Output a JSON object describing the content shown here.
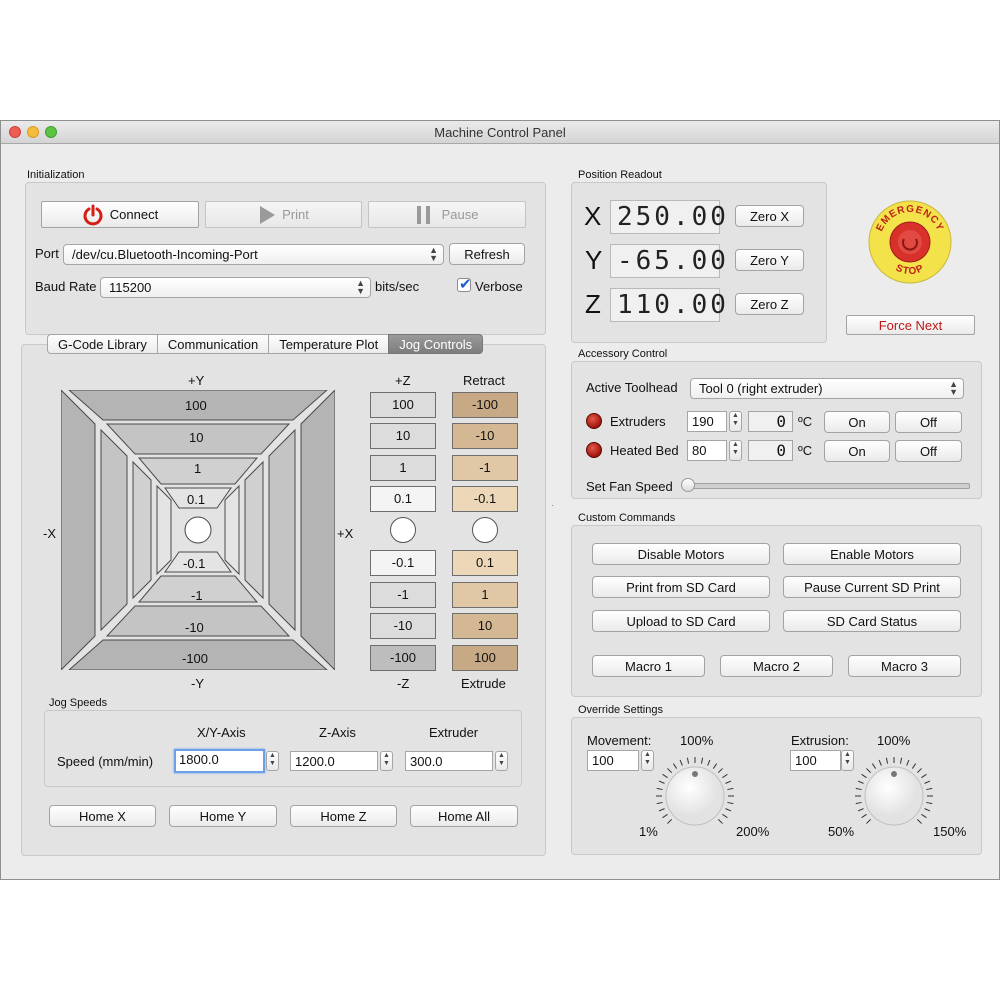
{
  "window": {
    "title": "Machine Control Panel"
  },
  "initialization": {
    "label": "Initialization",
    "connect": "Connect",
    "print": "Print",
    "pause": "Pause",
    "port_label": "Port",
    "port_value": "/dev/cu.Bluetooth-Incoming-Port",
    "refresh": "Refresh",
    "baud_label": "Baud Rate",
    "baud_value": "115200",
    "baud_unit": "bits/sec",
    "verbose": "Verbose",
    "verbose_checked": true
  },
  "tabs": [
    "G-Code Library",
    "Communication",
    "Temperature Plot",
    "Jog Controls"
  ],
  "active_tab": "Jog Controls",
  "jog": {
    "plus_y": "+Y",
    "minus_y": "-Y",
    "minus_x": "-X",
    "plus_x": "+X",
    "plus_z": "+Z",
    "minus_z": "-Z",
    "retract": "Retract",
    "extrude": "Extrude",
    "xy_labels": [
      "100",
      "10",
      "1",
      "0.1",
      "-0.1",
      "-1",
      "-10",
      "-100"
    ],
    "z_labels": [
      "100",
      "10",
      "1",
      "0.1",
      "-0.1",
      "-1",
      "-10",
      "-100"
    ],
    "e_labels": [
      "-100",
      "-10",
      "-1",
      "-0.1",
      "0.1",
      "1",
      "10",
      "100"
    ]
  },
  "jog_speeds": {
    "label": "Jog Speeds",
    "col_xy": "X/Y-Axis",
    "col_z": "Z-Axis",
    "col_e": "Extruder",
    "row_label": "Speed (mm/min)",
    "xy_value": "1800.0",
    "z_value": "1200.0",
    "e_value": "300.0"
  },
  "home": {
    "x": "Home X",
    "y": "Home Y",
    "z": "Home Z",
    "all": "Home All"
  },
  "position": {
    "label": "Position Readout",
    "x_label": "X",
    "x_value": "250.00",
    "zero_x": "Zero X",
    "y_label": "Y",
    "y_value": "-65.00",
    "zero_y": "Zero Y",
    "z_label": "Z",
    "z_value": "110.00",
    "zero_z": "Zero Z"
  },
  "emergency": {
    "top": "EMERGENCY",
    "bottom": "STOP",
    "force_next": "Force Next"
  },
  "accessory": {
    "label": "Accessory Control",
    "toolhead_label": "Active Toolhead",
    "toolhead_value": "Tool 0 (right extruder)",
    "extruders_label": "Extruders",
    "extruders_target": "190",
    "extruders_current": "0",
    "bed_label": "Heated Bed",
    "bed_target": "80",
    "bed_current": "0",
    "unit": "ºC",
    "on": "On",
    "off": "Off",
    "fan_label": "Set Fan Speed",
    "fan_level": 0
  },
  "custom": {
    "label": "Custom Commands",
    "disable_motors": "Disable Motors",
    "enable_motors": "Enable Motors",
    "print_sd": "Print from SD Card",
    "pause_sd": "Pause Current SD Print",
    "upload_sd": "Upload to SD Card",
    "sd_status": "SD Card Status",
    "macro1": "Macro 1",
    "macro2": "Macro 2",
    "macro3": "Macro 3"
  },
  "override": {
    "label": "Override Settings",
    "movement_label": "Movement:",
    "movement_pct": "100%",
    "movement_value": "100",
    "movement_min": "1%",
    "movement_max": "200%",
    "extrusion_label": "Extrusion:",
    "extrusion_pct": "100%",
    "extrusion_value": "100",
    "extrusion_min": "50%",
    "extrusion_max": "150%"
  },
  "colors": {
    "extrude_light": "#ecd8b8",
    "extrude_mid": "#dcc09a",
    "extrude_dark": "#c7aa85",
    "estop_yellow": "#f3e24a",
    "estop_red": "#d8302a",
    "force_next_text": "#c01818",
    "led_red": "#b01a10"
  }
}
